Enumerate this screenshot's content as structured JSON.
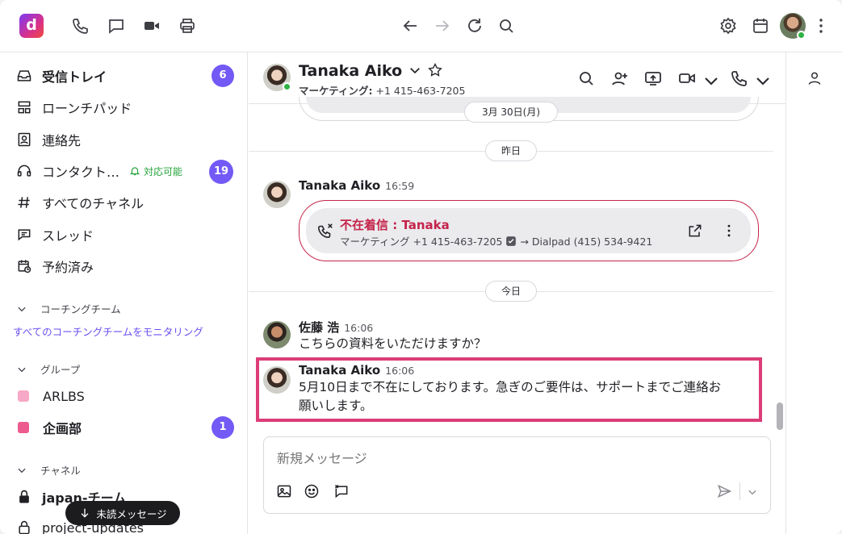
{
  "topbar": {
    "logo_letter": "d",
    "icons": [
      "phone-icon",
      "chat-icon",
      "video-icon",
      "printer-icon",
      "back-arrow-icon",
      "forward-arrow-icon",
      "refresh-icon",
      "search-icon",
      "gear-icon",
      "calendar-icon",
      "more-vertical-icon"
    ]
  },
  "sidebar": {
    "items": [
      {
        "label": "受信トレイ",
        "icon": "inbox-icon",
        "badge": "6",
        "bold": true
      },
      {
        "label": "ローンチパッド",
        "icon": "launchpad-icon"
      },
      {
        "label": "連絡先",
        "icon": "contacts-icon"
      },
      {
        "label": "コンタクト…",
        "icon": "headset-icon",
        "status": "対応可能",
        "badge": "19"
      },
      {
        "label": "すべてのチャネル",
        "icon": "hash-icon"
      },
      {
        "label": "スレッド",
        "icon": "threads-icon"
      },
      {
        "label": "予約済み",
        "icon": "scheduled-icon"
      }
    ],
    "coaching": {
      "header": "コーチングチーム",
      "link": "すべてのコーチングチームをモニタリング"
    },
    "groups": {
      "header": "グループ",
      "items": [
        {
          "label": "ARLBS",
          "color": "#f7a8c6"
        },
        {
          "label": "企画部",
          "color": "#ec5a8e",
          "badge": "1",
          "bold": true
        }
      ]
    },
    "channels": {
      "header": "チャネル",
      "items": [
        {
          "label": "japan-チーム",
          "bold": true
        },
        {
          "label": "project-updates"
        }
      ]
    },
    "unread_button": "未読メッセージ"
  },
  "chat": {
    "name": "Tanaka Aiko",
    "subtitle_label": "マーケティング:",
    "subtitle_phone": "+1 415-463-7205",
    "dates": {
      "old": "3月 30日(月)",
      "yesterday": "昨日",
      "today": "今日"
    },
    "messages": [
      {
        "sender": "Tanaka Aiko",
        "time": "16:59",
        "missed_call": {
          "title": "不在着信 : Tanaka",
          "detail": "マーケティング +1 415-463-7205",
          "forward": "→ Dialpad (415) 534-9421"
        }
      },
      {
        "sender": "佐藤 浩",
        "time": "16:06",
        "text": "こちらの資料をいただけますか？"
      },
      {
        "sender": "Tanaka Aiko",
        "time": "16:06",
        "text_line1": "5月10日まで不在にしております。急ぎのご要件は、サポートまでご連絡お",
        "text_line2": "願いします。"
      }
    ],
    "composer": {
      "placeholder": "新規メッセージ"
    }
  },
  "colors": {
    "accent": "#7359f5",
    "missed": "#c4244a",
    "highlight": "#dc3d79",
    "online": "#2fb344"
  }
}
